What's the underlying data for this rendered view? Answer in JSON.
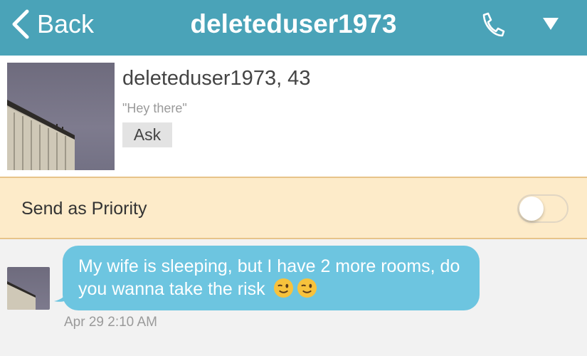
{
  "header": {
    "back_label": "Back",
    "title": "deleteduser1973",
    "background": "#4aa3b8",
    "icons": {
      "back": "chevron-left-icon",
      "call": "phone-icon",
      "menu": "triangle-down-icon"
    }
  },
  "profile": {
    "name_age": "deleteduser1973, 43",
    "status": "\"Hey there\"",
    "ask_label": "Ask"
  },
  "priority": {
    "label": "Send as Priority",
    "enabled": false,
    "background": "#fdebc9"
  },
  "messages": [
    {
      "text": "My wife is sleeping, but I have 2 more rooms, do you wanna take the risk",
      "emojis": [
        "winking-face-icon",
        "winking-face-icon"
      ],
      "timestamp": "Apr 29 2:10 AM",
      "bubble_color": "#6dc5e0"
    }
  ]
}
